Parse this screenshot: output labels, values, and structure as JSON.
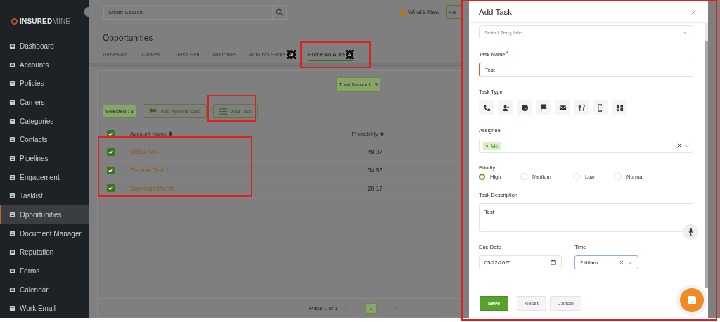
{
  "sidebar": {
    "logo": {
      "bold": "INSURED",
      "light": "MINE"
    },
    "items": [
      {
        "label": "Dashboard",
        "selected": false
      },
      {
        "label": "Accounts",
        "selected": false
      },
      {
        "label": "Policies",
        "selected": false
      },
      {
        "label": "Carriers",
        "selected": false
      },
      {
        "label": "Categories",
        "selected": false
      },
      {
        "label": "Contacts",
        "selected": false
      },
      {
        "label": "Pipelines",
        "selected": false
      },
      {
        "label": "Engagement",
        "selected": false
      },
      {
        "label": "Tasklist",
        "selected": false
      },
      {
        "label": "Opportunities",
        "selected": true
      },
      {
        "label": "Document Manager",
        "selected": false
      },
      {
        "label": "Reputation",
        "selected": false
      },
      {
        "label": "Forms",
        "selected": false
      },
      {
        "label": "Calendar",
        "selected": false
      },
      {
        "label": "Work Email",
        "selected": false
      }
    ]
  },
  "topbar": {
    "search": {
      "placeholder": "Smart Search"
    },
    "whats_new": "What's New",
    "cut_button": "Ad"
  },
  "page": {
    "title": "Opportunities",
    "tabs": [
      {
        "label": "Renewals",
        "selected": false
      },
      {
        "label": "X-dates",
        "selected": false
      },
      {
        "label": "Cross Sell",
        "selected": false
      },
      {
        "label": "Monoline",
        "selected": false
      },
      {
        "label": "Auto No Home",
        "selected": false,
        "badge": "AI"
      },
      {
        "label": "Home No Auto",
        "selected": true,
        "badge": "AI"
      }
    ]
  },
  "total_account": "Total Account : 3",
  "toolbar": {
    "selected_count": "Selected : 3",
    "buttons": [
      "Add Pipeline Card",
      "Add Task"
    ]
  },
  "table": {
    "all_checked": true,
    "columns": [
      "Account Name",
      "Probability"
    ],
    "rows": [
      {
        "name": "Shilpa N/A",
        "probability": "49.37",
        "checked": true
      },
      {
        "name": "Zishaan Test 1",
        "probability": "34.55",
        "checked": true
      },
      {
        "name": "Sayantan Mishra",
        "probability": "20.17",
        "checked": true
      }
    ]
  },
  "pagination": {
    "label": "Page 1 of 1",
    "pages": [
      {
        "label": "1",
        "selected": true
      }
    ]
  },
  "modal": {
    "title": "Add Task",
    "template": {
      "placeholder": "Select Template"
    },
    "task_name": {
      "label": "Task Name",
      "required": true,
      "value": "Test"
    },
    "task_type": {
      "label": "Task Type"
    },
    "assignee": {
      "label": "Assignee",
      "tags": [
        "Me"
      ]
    },
    "priority": {
      "label": "Priority",
      "options": [
        {
          "label": "High",
          "selected": true
        },
        {
          "label": "Medium",
          "selected": false
        },
        {
          "label": "Low",
          "selected": false
        },
        {
          "label": "Normal",
          "selected": false
        }
      ]
    },
    "description": {
      "label": "Task Description",
      "value": "Test"
    },
    "due_date": {
      "label": "Due Date",
      "value": "05/22/2025"
    },
    "time": {
      "label": "Time",
      "value": "2:00am"
    },
    "buttons": [
      "Save",
      "Reset",
      "Cancel"
    ]
  }
}
